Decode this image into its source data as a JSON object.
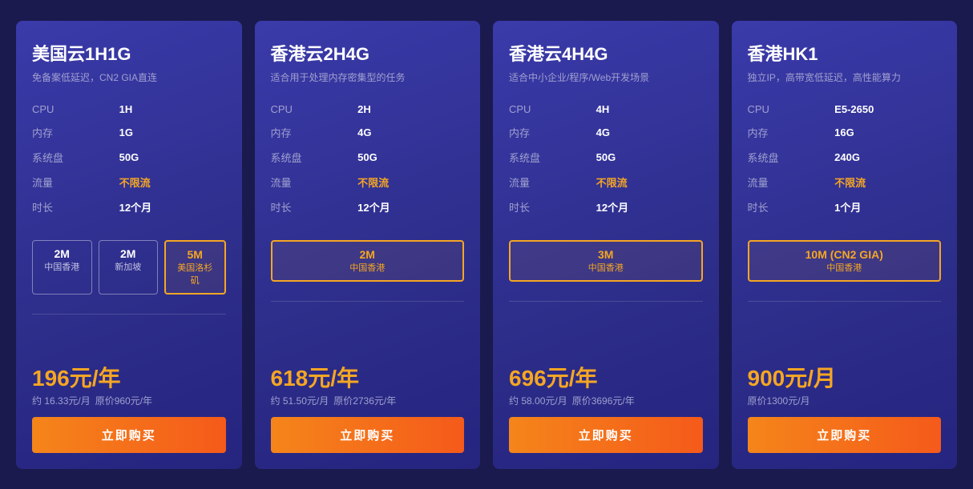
{
  "cards": [
    {
      "id": "card-us-1h1g",
      "title": "美国云1H1G",
      "subtitle": "免备案低延迟，CN2 GIA直连",
      "specs": [
        {
          "label": "CPU",
          "value": "1H",
          "unlimited": false
        },
        {
          "label": "内存",
          "value": "1G",
          "unlimited": false
        },
        {
          "label": "系统盘",
          "value": "50G",
          "unlimited": false
        },
        {
          "label": "流量",
          "value": "不限流",
          "unlimited": true
        },
        {
          "label": "时长",
          "value": "12个月",
          "unlimited": false
        }
      ],
      "bandwidth_options": [
        {
          "speed": "2M",
          "region": "中国香港",
          "selected": false
        },
        {
          "speed": "2M",
          "region": "新加坡",
          "selected": false
        },
        {
          "speed": "5M",
          "region": "美国洛杉矶",
          "selected": true
        }
      ],
      "price_main": "196元/年",
      "price_sub1": "约 16.33元/月",
      "price_sub2": "原价960元/年",
      "buy_label": "立即购买"
    },
    {
      "id": "card-hk-2h4g",
      "title": "香港云2H4G",
      "subtitle": "适合用于处理内存密集型的任务",
      "specs": [
        {
          "label": "CPU",
          "value": "2H",
          "unlimited": false
        },
        {
          "label": "内存",
          "value": "4G",
          "unlimited": false
        },
        {
          "label": "系统盘",
          "value": "50G",
          "unlimited": false
        },
        {
          "label": "流量",
          "value": "不限流",
          "unlimited": true
        },
        {
          "label": "时长",
          "value": "12个月",
          "unlimited": false
        }
      ],
      "bandwidth_options": [
        {
          "speed": "2M",
          "region": "中国香港",
          "selected": true
        }
      ],
      "price_main": "618元/年",
      "price_sub1": "约 51.50元/月",
      "price_sub2": "原价2736元/年",
      "buy_label": "立即购买"
    },
    {
      "id": "card-hk-4h4g",
      "title": "香港云4H4G",
      "subtitle": "适合中小企业/程序/Web开发场景",
      "specs": [
        {
          "label": "CPU",
          "value": "4H",
          "unlimited": false
        },
        {
          "label": "内存",
          "value": "4G",
          "unlimited": false
        },
        {
          "label": "系统盘",
          "value": "50G",
          "unlimited": false
        },
        {
          "label": "流量",
          "value": "不限流",
          "unlimited": true
        },
        {
          "label": "时长",
          "value": "12个月",
          "unlimited": false
        }
      ],
      "bandwidth_options": [
        {
          "speed": "3M",
          "region": "中国香港",
          "selected": true
        }
      ],
      "price_main": "696元/年",
      "price_sub1": "约 58.00元/月",
      "price_sub2": "原价3696元/年",
      "buy_label": "立即购买"
    },
    {
      "id": "card-hk-hk1",
      "title": "香港HK1",
      "subtitle": "独立IP，高带宽低延迟，高性能算力",
      "specs": [
        {
          "label": "CPU",
          "value": "E5-2650",
          "unlimited": false
        },
        {
          "label": "内存",
          "value": "16G",
          "unlimited": false
        },
        {
          "label": "系统盘",
          "value": "240G",
          "unlimited": false
        },
        {
          "label": "流量",
          "value": "不限流",
          "unlimited": true
        },
        {
          "label": "时长",
          "value": "1个月",
          "unlimited": false
        }
      ],
      "bandwidth_options": [
        {
          "speed": "10M (CN2 GIA)",
          "region": "中国香港",
          "selected": true
        }
      ],
      "price_main": "900元/月",
      "price_sub1": "",
      "price_sub2": "原价1300元/月",
      "buy_label": "立即购买"
    }
  ]
}
